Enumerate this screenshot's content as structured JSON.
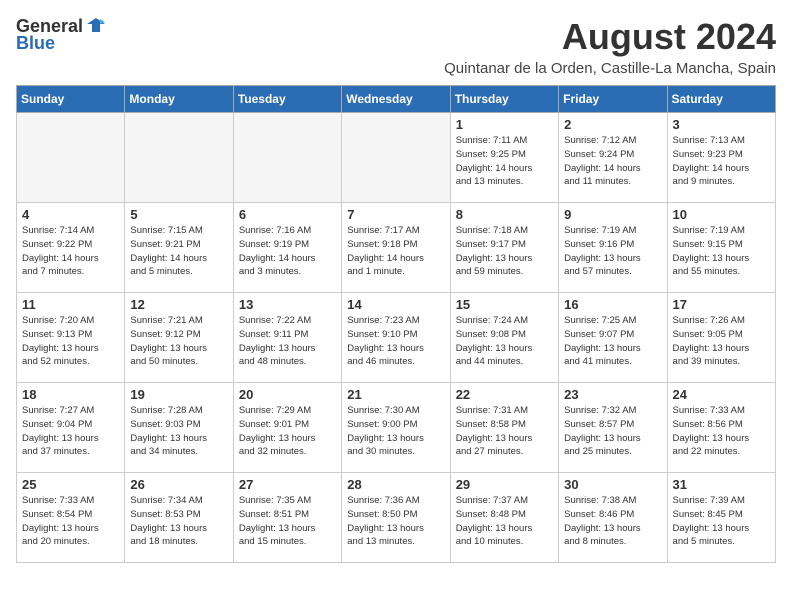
{
  "logo": {
    "general": "General",
    "blue": "Blue"
  },
  "title": "August 2024",
  "subtitle": "Quintanar de la Orden, Castille-La Mancha, Spain",
  "headers": [
    "Sunday",
    "Monday",
    "Tuesday",
    "Wednesday",
    "Thursday",
    "Friday",
    "Saturday"
  ],
  "weeks": [
    [
      {
        "day": "",
        "info": ""
      },
      {
        "day": "",
        "info": ""
      },
      {
        "day": "",
        "info": ""
      },
      {
        "day": "",
        "info": ""
      },
      {
        "day": "1",
        "info": "Sunrise: 7:11 AM\nSunset: 9:25 PM\nDaylight: 14 hours\nand 13 minutes."
      },
      {
        "day": "2",
        "info": "Sunrise: 7:12 AM\nSunset: 9:24 PM\nDaylight: 14 hours\nand 11 minutes."
      },
      {
        "day": "3",
        "info": "Sunrise: 7:13 AM\nSunset: 9:23 PM\nDaylight: 14 hours\nand 9 minutes."
      }
    ],
    [
      {
        "day": "4",
        "info": "Sunrise: 7:14 AM\nSunset: 9:22 PM\nDaylight: 14 hours\nand 7 minutes."
      },
      {
        "day": "5",
        "info": "Sunrise: 7:15 AM\nSunset: 9:21 PM\nDaylight: 14 hours\nand 5 minutes."
      },
      {
        "day": "6",
        "info": "Sunrise: 7:16 AM\nSunset: 9:19 PM\nDaylight: 14 hours\nand 3 minutes."
      },
      {
        "day": "7",
        "info": "Sunrise: 7:17 AM\nSunset: 9:18 PM\nDaylight: 14 hours\nand 1 minute."
      },
      {
        "day": "8",
        "info": "Sunrise: 7:18 AM\nSunset: 9:17 PM\nDaylight: 13 hours\nand 59 minutes."
      },
      {
        "day": "9",
        "info": "Sunrise: 7:19 AM\nSunset: 9:16 PM\nDaylight: 13 hours\nand 57 minutes."
      },
      {
        "day": "10",
        "info": "Sunrise: 7:19 AM\nSunset: 9:15 PM\nDaylight: 13 hours\nand 55 minutes."
      }
    ],
    [
      {
        "day": "11",
        "info": "Sunrise: 7:20 AM\nSunset: 9:13 PM\nDaylight: 13 hours\nand 52 minutes."
      },
      {
        "day": "12",
        "info": "Sunrise: 7:21 AM\nSunset: 9:12 PM\nDaylight: 13 hours\nand 50 minutes."
      },
      {
        "day": "13",
        "info": "Sunrise: 7:22 AM\nSunset: 9:11 PM\nDaylight: 13 hours\nand 48 minutes."
      },
      {
        "day": "14",
        "info": "Sunrise: 7:23 AM\nSunset: 9:10 PM\nDaylight: 13 hours\nand 46 minutes."
      },
      {
        "day": "15",
        "info": "Sunrise: 7:24 AM\nSunset: 9:08 PM\nDaylight: 13 hours\nand 44 minutes."
      },
      {
        "day": "16",
        "info": "Sunrise: 7:25 AM\nSunset: 9:07 PM\nDaylight: 13 hours\nand 41 minutes."
      },
      {
        "day": "17",
        "info": "Sunrise: 7:26 AM\nSunset: 9:05 PM\nDaylight: 13 hours\nand 39 minutes."
      }
    ],
    [
      {
        "day": "18",
        "info": "Sunrise: 7:27 AM\nSunset: 9:04 PM\nDaylight: 13 hours\nand 37 minutes."
      },
      {
        "day": "19",
        "info": "Sunrise: 7:28 AM\nSunset: 9:03 PM\nDaylight: 13 hours\nand 34 minutes."
      },
      {
        "day": "20",
        "info": "Sunrise: 7:29 AM\nSunset: 9:01 PM\nDaylight: 13 hours\nand 32 minutes."
      },
      {
        "day": "21",
        "info": "Sunrise: 7:30 AM\nSunset: 9:00 PM\nDaylight: 13 hours\nand 30 minutes."
      },
      {
        "day": "22",
        "info": "Sunrise: 7:31 AM\nSunset: 8:58 PM\nDaylight: 13 hours\nand 27 minutes."
      },
      {
        "day": "23",
        "info": "Sunrise: 7:32 AM\nSunset: 8:57 PM\nDaylight: 13 hours\nand 25 minutes."
      },
      {
        "day": "24",
        "info": "Sunrise: 7:33 AM\nSunset: 8:56 PM\nDaylight: 13 hours\nand 22 minutes."
      }
    ],
    [
      {
        "day": "25",
        "info": "Sunrise: 7:33 AM\nSunset: 8:54 PM\nDaylight: 13 hours\nand 20 minutes."
      },
      {
        "day": "26",
        "info": "Sunrise: 7:34 AM\nSunset: 8:53 PM\nDaylight: 13 hours\nand 18 minutes."
      },
      {
        "day": "27",
        "info": "Sunrise: 7:35 AM\nSunset: 8:51 PM\nDaylight: 13 hours\nand 15 minutes."
      },
      {
        "day": "28",
        "info": "Sunrise: 7:36 AM\nSunset: 8:50 PM\nDaylight: 13 hours\nand 13 minutes."
      },
      {
        "day": "29",
        "info": "Sunrise: 7:37 AM\nSunset: 8:48 PM\nDaylight: 13 hours\nand 10 minutes."
      },
      {
        "day": "30",
        "info": "Sunrise: 7:38 AM\nSunset: 8:46 PM\nDaylight: 13 hours\nand 8 minutes."
      },
      {
        "day": "31",
        "info": "Sunrise: 7:39 AM\nSunset: 8:45 PM\nDaylight: 13 hours\nand 5 minutes."
      }
    ]
  ]
}
